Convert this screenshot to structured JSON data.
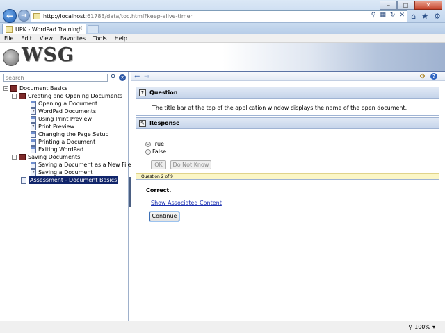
{
  "browser": {
    "url_host": "http://localhost",
    "url_rest": ":61783/data/toc.html?keep-alive-timer",
    "tab_title": "UPK - WordPad Training",
    "tab_close": "×",
    "min": "‒",
    "max": "□",
    "close": "✕",
    "zoom": "100%"
  },
  "menu": [
    "File",
    "Edit",
    "View",
    "Favorites",
    "Tools",
    "Help"
  ],
  "banner": {
    "logo": "WSG"
  },
  "toc": {
    "search_placeholder": "search",
    "items": [
      {
        "label": "Document Basics"
      },
      {
        "label": "Creating and Opening Documents"
      },
      {
        "label": "Opening a Document"
      },
      {
        "label": "WordPad Documents"
      },
      {
        "label": "Using Print Preview"
      },
      {
        "label": "Print Preview"
      },
      {
        "label": "Changing the Page Setup"
      },
      {
        "label": "Printing a Document"
      },
      {
        "label": "Exiting WordPad"
      },
      {
        "label": "Saving Documents"
      },
      {
        "label": "Saving a Document as a New File"
      },
      {
        "label": "Saving a Document"
      },
      {
        "label": "Assessment - Document Basics"
      }
    ]
  },
  "assessment": {
    "question_header": "Question",
    "question_text": "The title bar at the top of the application window displays the name of the open document.",
    "response_header": "Response",
    "options": [
      "True",
      "False"
    ],
    "ok_label": "OK",
    "dnk_label": "Do Not Know",
    "progress": "Question 2 of 9",
    "result": "Correct.",
    "link": "Show Associated Content",
    "continue_label": "Continue"
  }
}
